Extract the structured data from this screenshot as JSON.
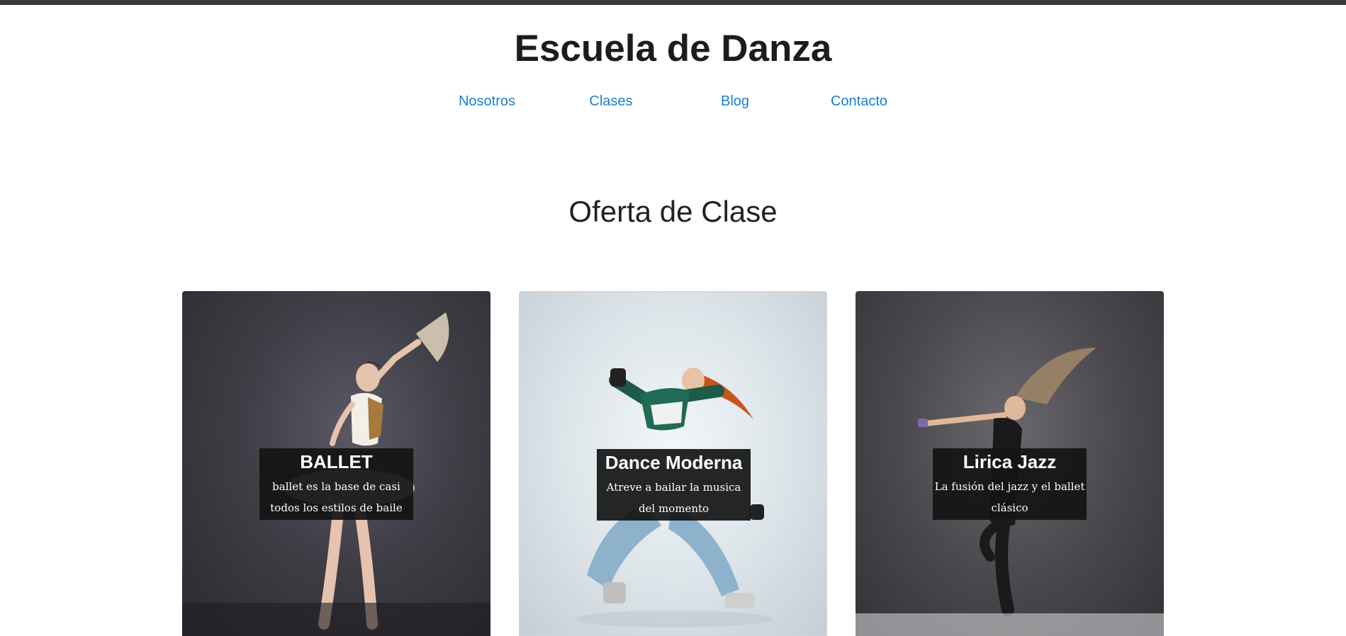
{
  "header": {
    "title": "Escuela de Danza",
    "nav": [
      "Nosotros",
      "Clases",
      "Blog",
      "Contacto"
    ]
  },
  "main": {
    "section_title": "Oferta de Clase",
    "cards": [
      {
        "title": "BALLET",
        "description": "ballet es la base de casi todos los estilos de baile"
      },
      {
        "title": "Dance Moderna",
        "description": "Atreve a bailar la musica del momento"
      },
      {
        "title": "Lirica Jazz",
        "description": "La fusión del jazz y el ballet clásico"
      }
    ]
  },
  "colors": {
    "topbar": "#3a3a3a",
    "link": "#1a7fd1",
    "title": "#1c1c1c"
  }
}
